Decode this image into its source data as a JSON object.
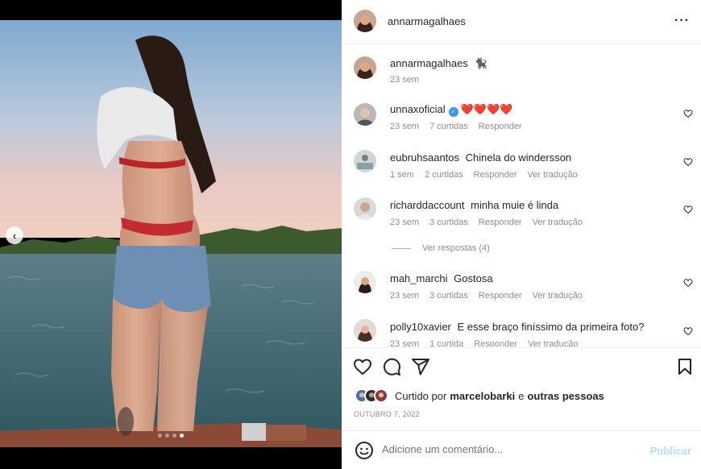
{
  "post": {
    "author": "annarmagalhaes",
    "carousel": {
      "slides": 4,
      "active": 4
    }
  },
  "caption": {
    "username": "annarmagalhaes",
    "text": "🐈‍⬛",
    "time": "23 sem"
  },
  "comments": [
    {
      "username": "unnaxoficial",
      "verified": true,
      "text": "❤️❤️❤️❤️",
      "time": "23 sem",
      "likes": "7 curtidas",
      "reply": "Responder",
      "translate": ""
    },
    {
      "username": "eubruhsaantos",
      "verified": false,
      "text": "Chinela do windersson",
      "time": "1 sem",
      "likes": "2 curtidas",
      "reply": "Responder",
      "translate": "Ver tradução"
    },
    {
      "username": "richarddaccount",
      "verified": false,
      "text": "minha muie é linda",
      "time": "23 sem",
      "likes": "3 curtidas",
      "reply": "Responder",
      "translate": "Ver tradução"
    },
    {
      "username": "mah_marchi",
      "verified": false,
      "text": "Gostosa",
      "time": "23 sem",
      "likes": "3 curtidas",
      "reply": "Responder",
      "translate": "Ver tradução"
    },
    {
      "username": "polly10xavier",
      "verified": false,
      "text": "E esse braço finíssimo da primeira foto?",
      "time": "23 sem",
      "likes": "1 curtida",
      "reply": "Responder",
      "translate": "Ver tradução"
    }
  ],
  "view_replies": "Ver respostas (4)",
  "likes": {
    "prefix": "Curtido por",
    "user": "marcelobarki",
    "suffix": "e",
    "others": "outras pessoas"
  },
  "date": "OUTUBRO 7, 2022",
  "add_comment": {
    "placeholder": "Adicione um comentário...",
    "publish": "Publicar"
  },
  "icons": {
    "more": "more-horizontal-icon",
    "like": "heart-icon",
    "comment": "comment-icon",
    "share": "send-icon",
    "save": "bookmark-icon",
    "emoji": "emoji-icon",
    "carousel_prev": "chevron-left-icon"
  },
  "colors": {
    "link": "#0095f6",
    "publish_disabled": "#b2dffc",
    "heart": "#ed4956",
    "muted": "#8e8e8e"
  }
}
